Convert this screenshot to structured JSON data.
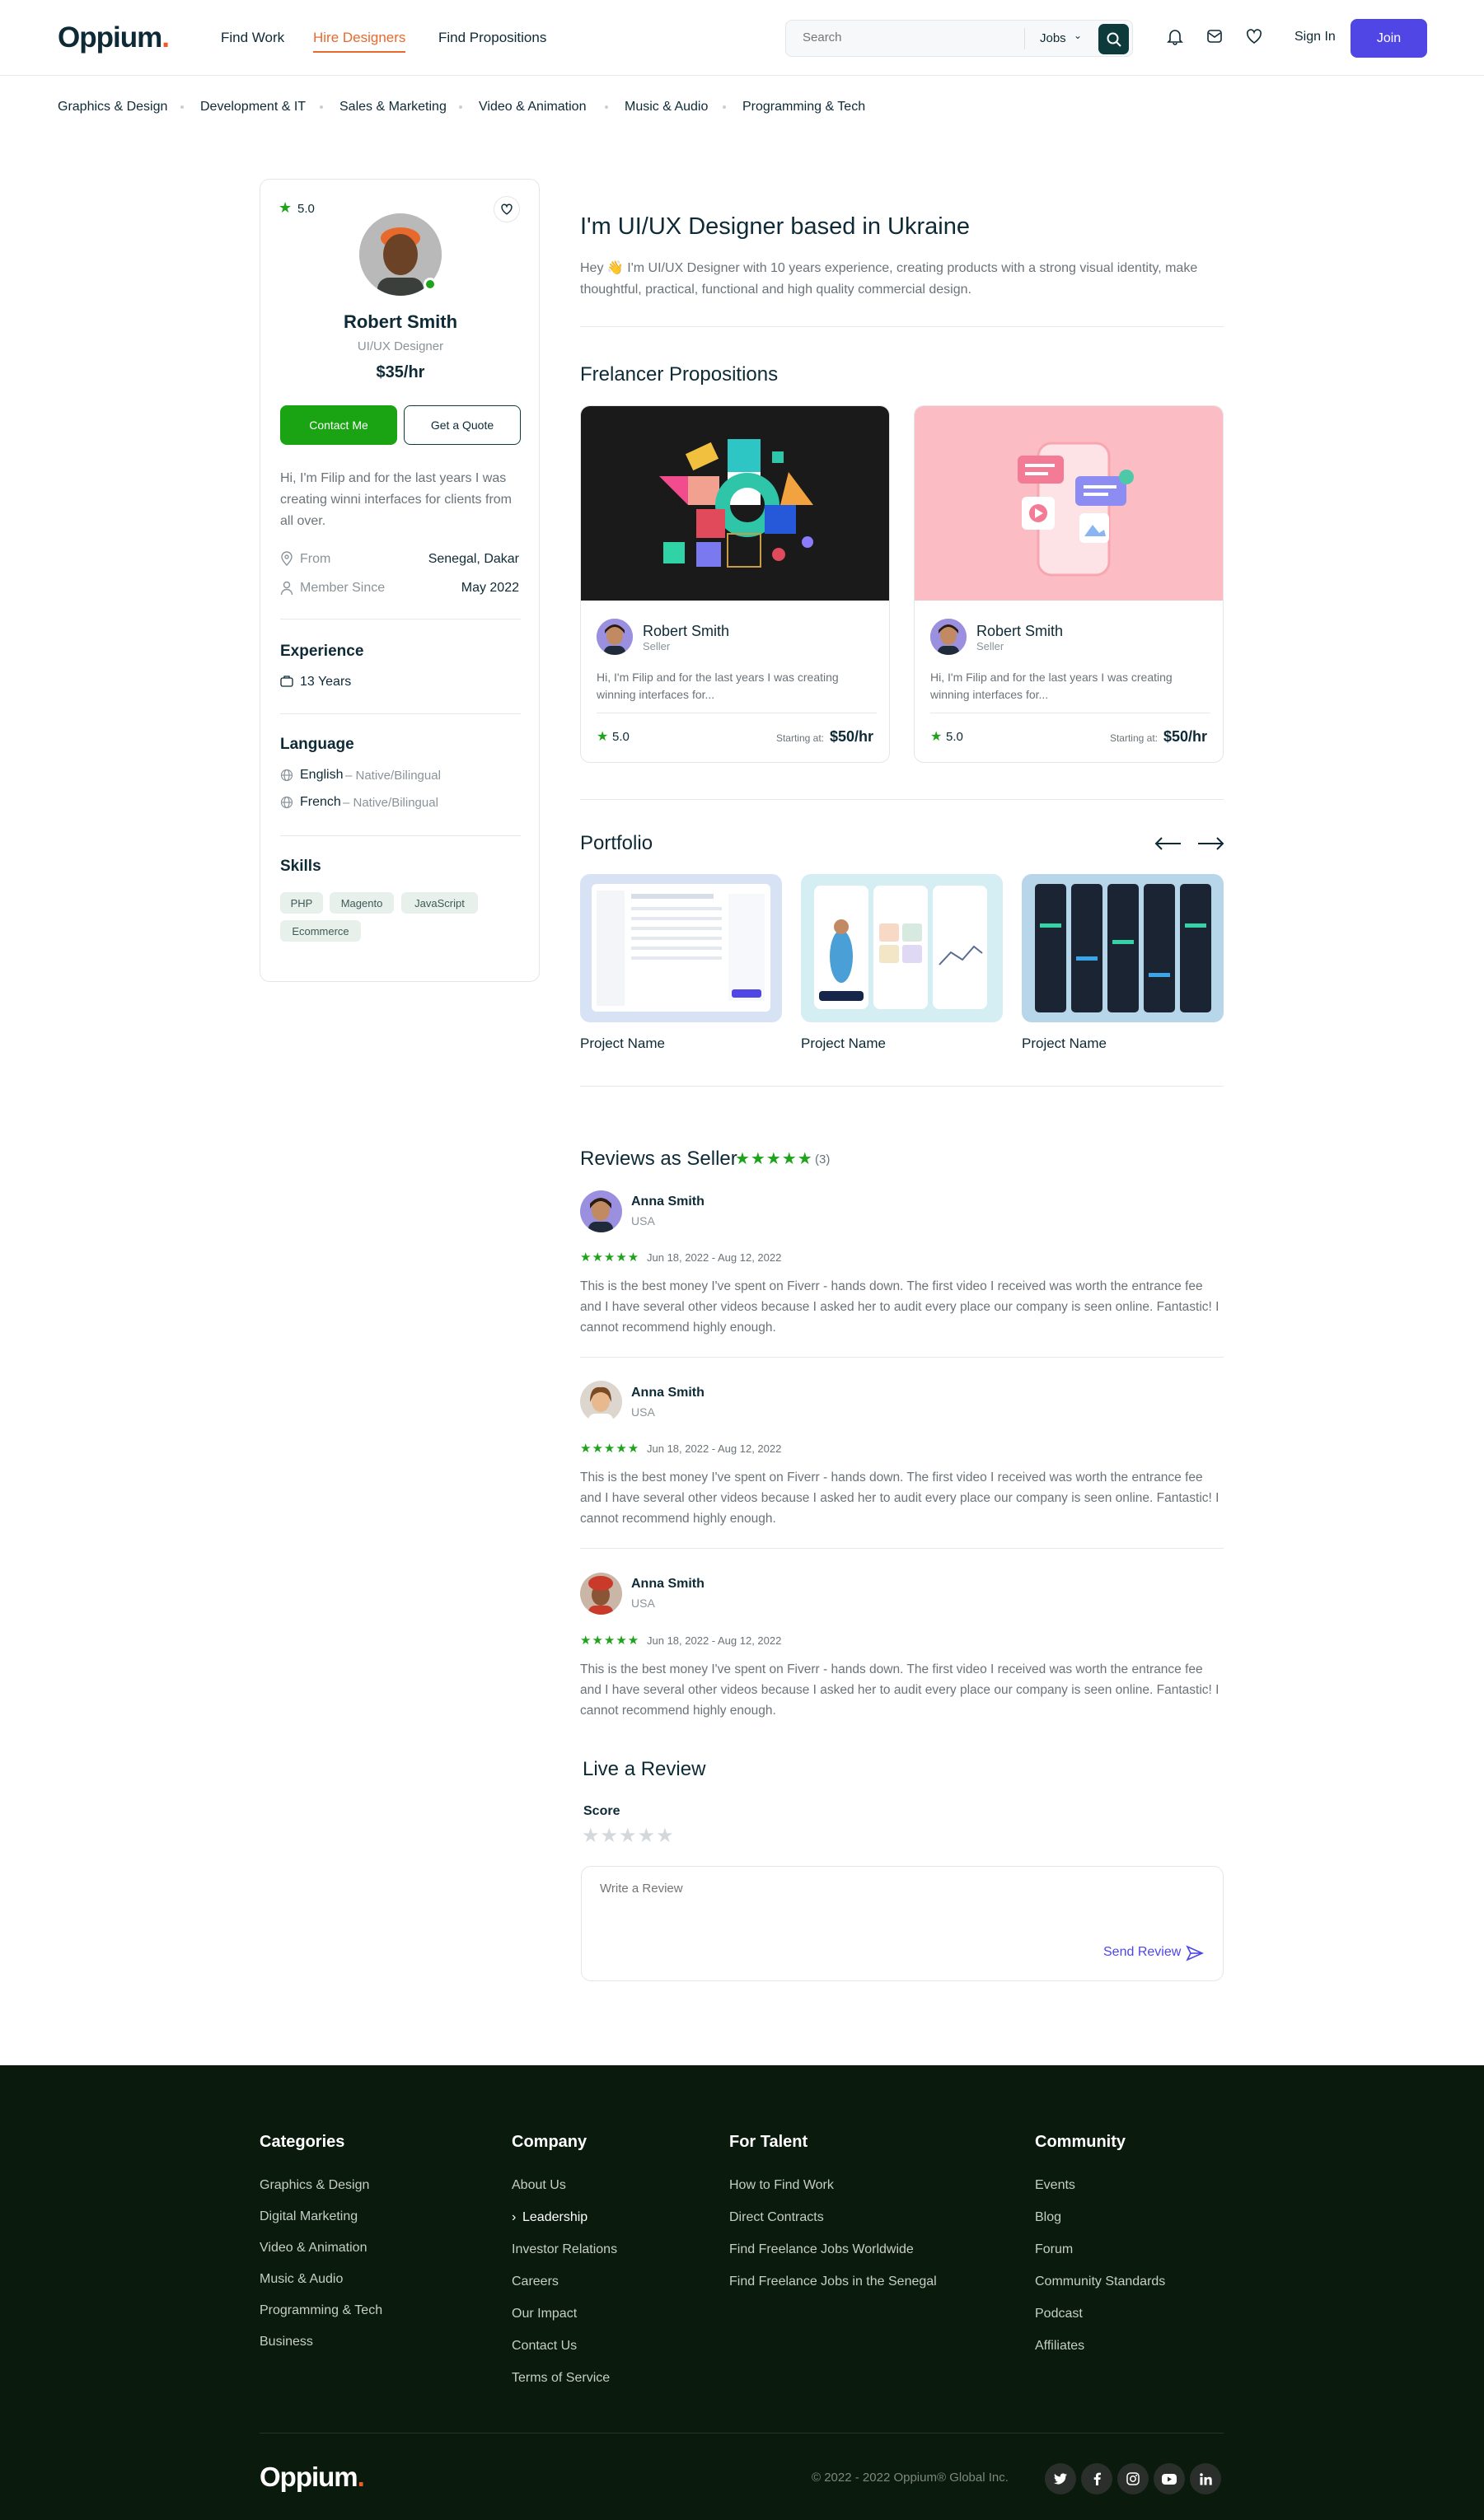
{
  "header": {
    "logo": "Oppium",
    "logo_dot": ".",
    "nav": [
      "Find Work",
      "Hire Designers",
      "Find Propositions"
    ],
    "search_placeholder": "Search",
    "search_scope": "Jobs",
    "sign_in": "Sign In",
    "join": "Join",
    "brand_color": "#4f46e5",
    "active_color": "#e8692c"
  },
  "categories": [
    "Graphics & Design",
    "Development & IT",
    "Sales & Marketing",
    "Video & Animation",
    "Music & Audio",
    "Programming & Tech"
  ],
  "profile": {
    "rating": "5.0",
    "name": "Robert Smith",
    "role": "UI/UX Designer",
    "rate": "$35/hr",
    "contact": "Contact Me",
    "quote": "Get a Quote",
    "bio": "Hi, I'm Filip and for the last years I was creating winni interfaces for clients from all over.",
    "from_label": "From",
    "from_value": "Senegal, Dakar",
    "since_label": "Member Since",
    "since_value": "May 2022",
    "experience_title": "Experience",
    "experience": "13 Years",
    "language_title": "Language",
    "languages": [
      {
        "name": "English",
        "level": "– Native/Bilingual"
      },
      {
        "name": "French",
        "level": "– Native/Bilingual"
      }
    ],
    "skills_title": "Skills",
    "skills": [
      "PHP",
      "Magento",
      "JavaScript",
      "Ecommerce"
    ]
  },
  "main": {
    "title": "I'm UI/UX Designer based in Ukraine",
    "intro_line1": "Hey 👋 I'm UI/UX Designer with 10 years experience, creating products with a strong visual identity, make",
    "intro_line2": "thoughtful, practical, functional and high quality commercial design.",
    "propositions_title": "Frelancer Propositions",
    "propositions": [
      {
        "name": "Robert Smith",
        "role": "Seller",
        "desc": "Hi, I'm Filip and for the last years I was creating winning interfaces for...",
        "rating": "5.0",
        "starting": "Starting at:",
        "price": "$50/hr"
      },
      {
        "name": "Robert Smith",
        "role": "Seller",
        "desc": "Hi, I'm Filip and for the last years I was creating winning interfaces for...",
        "rating": "5.0",
        "starting": "Starting at:",
        "price": "$50/hr"
      }
    ],
    "portfolio_title": "Portfolio",
    "portfolio": [
      "Project Name",
      "Project Name",
      "Project Name"
    ],
    "reviews_title": "Reviews as Seller",
    "reviews_count": "(3)",
    "reviews": [
      {
        "name": "Anna Smith",
        "country": "USA",
        "date": "Jun 18, 2022 - Aug 12, 2022",
        "text": "This is the best money I've spent on Fiverr - hands down. The first video I received was worth the entrance fee and I have several other videos because I asked her to audit every place our company is seen online. Fantastic! I cannot recommend highly enough."
      },
      {
        "name": "Anna Smith",
        "country": "USA",
        "date": "Jun 18, 2022 - Aug 12, 2022",
        "text": "This is the best money I've spent on Fiverr - hands down. The first video I received was worth the entrance fee and I have several other videos because I asked her to audit every place our company is seen online. Fantastic! I cannot recommend highly enough."
      },
      {
        "name": "Anna Smith",
        "country": "USA",
        "date": "Jun 18, 2022 - Aug 12, 2022",
        "text": "This is the best money I've spent on Fiverr - hands down. The first video I received was worth the entrance fee and I have several other videos because I asked her to audit every place our company is seen online. Fantastic! I cannot recommend highly enough."
      }
    ],
    "leave_review_title": "Live a Review",
    "score_label": "Score",
    "review_placeholder": "Write a Review",
    "send_review": "Send Review"
  },
  "footer": {
    "columns": [
      {
        "title": "Categories",
        "links": [
          "Graphics & Design",
          "Digital Marketing",
          "Video & Animation",
          "Music & Audio",
          "Programming & Tech",
          "Business"
        ]
      },
      {
        "title": "Company",
        "links": [
          "About Us",
          "Leadership",
          "Investor Relations",
          "Careers",
          "Our Impact",
          "Contact Us",
          "Terms of Service"
        ]
      },
      {
        "title": "For Talent",
        "links": [
          "How to Find Work",
          "Direct Contracts",
          "Find Freelance Jobs Worldwide",
          "Find Freelance Jobs in the Senegal"
        ]
      },
      {
        "title": "Community",
        "links": [
          "Events",
          "Blog",
          "Forum",
          "Community Standards",
          "Podcast",
          "Affiliates"
        ]
      }
    ],
    "logo": "Oppium",
    "logo_dot": ".",
    "copyright": "© 2022 - 2022 Oppium® Global Inc.",
    "social": [
      "twitter-icon",
      "facebook-icon",
      "instagram-icon",
      "youtube-icon",
      "linkedin-icon"
    ]
  }
}
